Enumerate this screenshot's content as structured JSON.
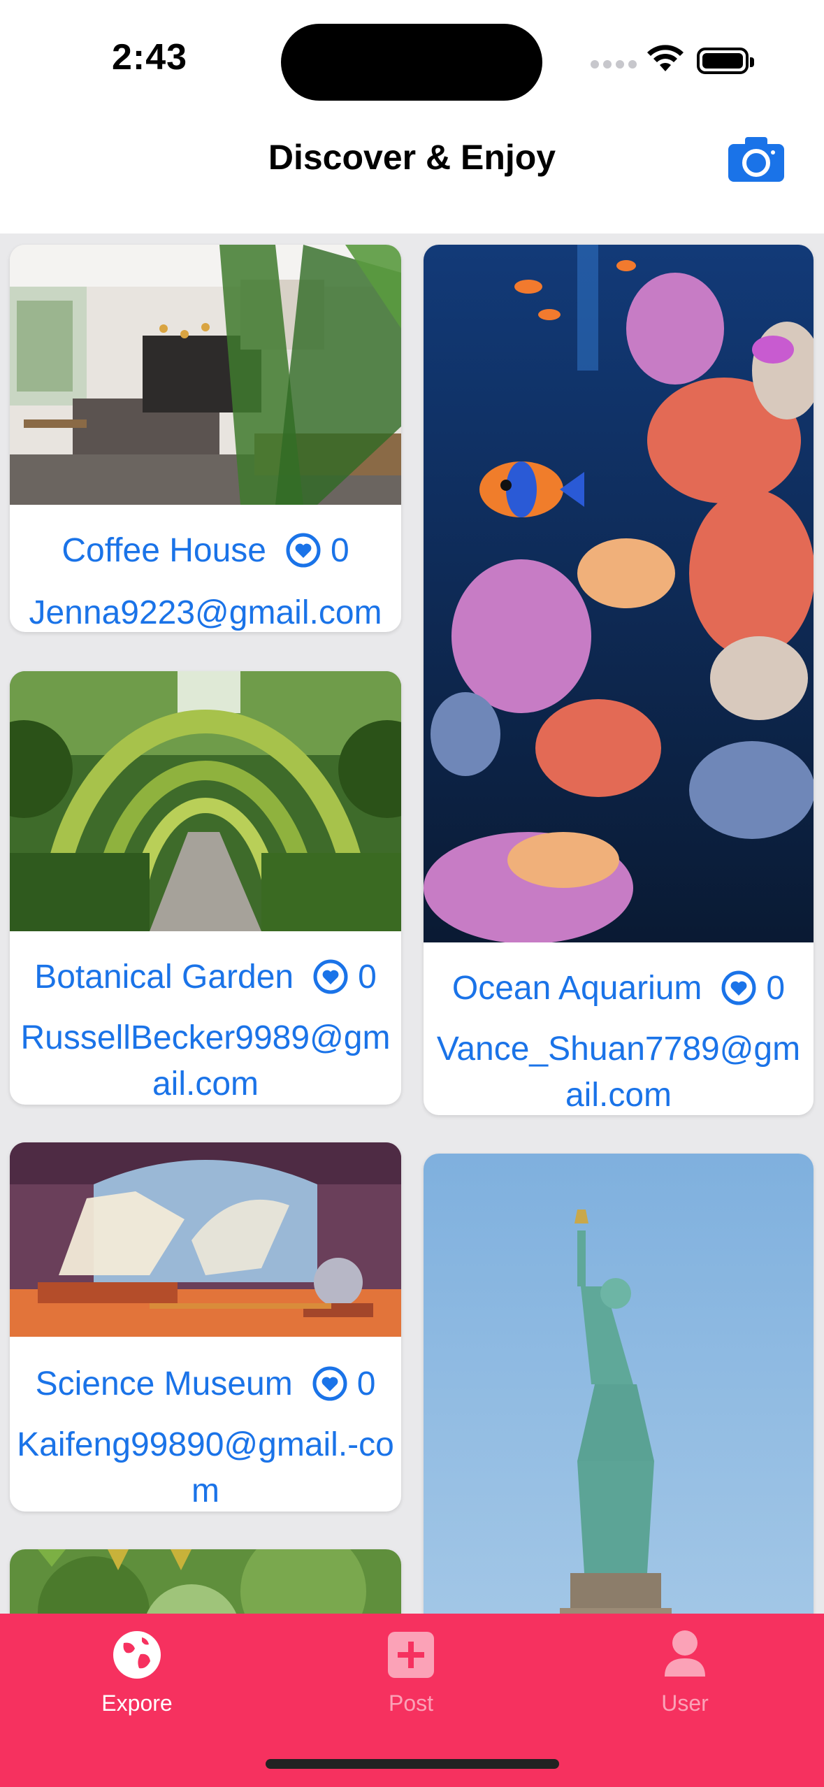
{
  "status": {
    "time": "2:43"
  },
  "header": {
    "title": "Discover & Enjoy",
    "camera_icon": "camera-icon"
  },
  "accent_color": "#1a73e8",
  "tabbar_color": "#f6315f",
  "cards": [
    {
      "name": "Coffee House",
      "likes": "0",
      "email": "Jenna9223@gmail.com"
    },
    {
      "name": "Ocean Aquarium",
      "likes": "0",
      "email": "Vance_Shuan7789@gmail.com"
    },
    {
      "name": "Botanical Garden",
      "likes": "0",
      "email": "RussellBecker9989@gmail.com"
    },
    {
      "name": "Science Museum",
      "likes": "0",
      "email": "Kaifeng99890@gmail.-com"
    }
  ],
  "tabs": [
    {
      "label": "Expore",
      "icon": "globe-icon",
      "active": true
    },
    {
      "label": "Post",
      "icon": "plus-square-icon",
      "active": false
    },
    {
      "label": "User",
      "icon": "person-icon",
      "active": false
    }
  ]
}
